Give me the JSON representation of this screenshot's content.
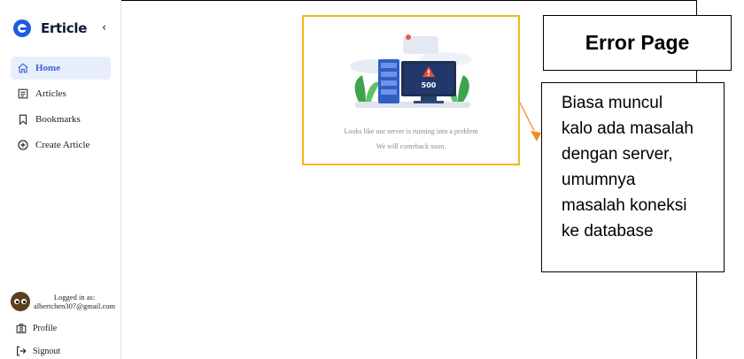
{
  "app": {
    "name": "Erticle",
    "collapse_icon": "chevron-left-icon"
  },
  "sidebar": {
    "items": [
      {
        "label": "Home",
        "icon": "home-icon",
        "active": true
      },
      {
        "label": "Articles",
        "icon": "articles-icon",
        "active": false
      },
      {
        "label": "Bookmarks",
        "icon": "bookmark-icon",
        "active": false
      },
      {
        "label": "Create Article",
        "icon": "plus-circle-icon",
        "active": false
      }
    ],
    "user": {
      "logged_in_label": "Logged in as:",
      "email": "albertchen307@gmail.com"
    },
    "footer": [
      {
        "label": "Profile",
        "icon": "profile-icon"
      },
      {
        "label": "Signout",
        "icon": "signout-icon"
      }
    ]
  },
  "error": {
    "code": "500",
    "line1": "Looks like our server is running into a problem",
    "line2": "We will comeback soon."
  },
  "annotation": {
    "title": "Error Page",
    "lines": [
      "Biasa muncul",
      "kalo ada masalah",
      "dengan server,",
      "umumnya",
      "masalah koneksi",
      "ke database"
    ]
  },
  "colors": {
    "accent": "#3a62d9",
    "active_bg": "#e8eefc",
    "highlight_border": "#f3b61b",
    "arrow": "#f08a2c"
  }
}
